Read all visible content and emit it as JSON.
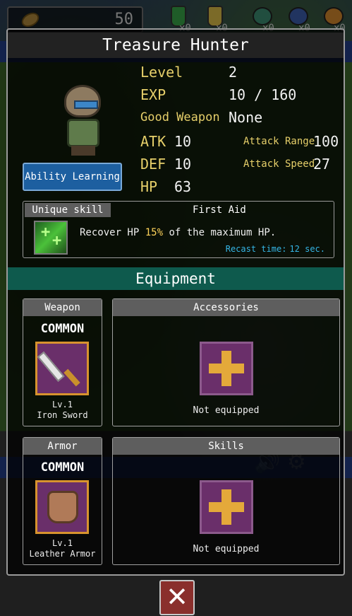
{
  "hud": {
    "gold": "50",
    "items": [
      {
        "icon": "green-potion-icon",
        "count": "x0",
        "color": "#3aa84a"
      },
      {
        "icon": "yellow-potion-icon",
        "count": "x0",
        "color": "#e0c24a"
      },
      {
        "icon": "green-fruit-icon",
        "count": "x0",
        "color": "#3d8f74"
      },
      {
        "icon": "blue-fruit-icon",
        "count": "x0",
        "color": "#3c5fb0"
      },
      {
        "icon": "orange-fruit-icon",
        "count": "x0",
        "color": "#d88a2e"
      }
    ]
  },
  "panel": {
    "title": "Treasure Hunter",
    "ability_button": "Ability Learning",
    "stats": {
      "level_label": "Level",
      "level_value": "2",
      "exp_label": "EXP",
      "exp_value": "10 / 160",
      "good_weapon_label": "Good Weapon",
      "good_weapon_value": "None",
      "atk_label": "ATK",
      "atk_value": "10",
      "def_label": "DEF",
      "def_value": "10",
      "hp_label": "HP",
      "hp_value": "63",
      "range_label": "Attack Range",
      "range_value": "100",
      "speed_label": "Attack Speed",
      "speed_value": "27"
    },
    "unique_skill": {
      "tag": "Unique skill",
      "name": "First Aid",
      "desc_before": "Recover HP",
      "desc_pct": "15%",
      "desc_after": "of the maximum HP.",
      "recast_label": "Recast time:",
      "recast_value": "12 sec."
    },
    "equipment_title": "Equipment",
    "weapon": {
      "header": "Weapon",
      "rarity": "COMMON",
      "level": "Lv.1",
      "name": "Iron Sword"
    },
    "accessories": {
      "header": "Accessories",
      "status": "Not equipped"
    },
    "armor": {
      "header": "Armor",
      "rarity": "COMMON",
      "level": "Lv.1",
      "name": "Leather Armor"
    },
    "skills": {
      "header": "Skills",
      "status": "Not equipped"
    }
  },
  "close_button": "✕",
  "colors": {
    "accent_gold": "#e6cf6a",
    "equipment_bar": "#0e5a4d",
    "recast": "#35b6e6",
    "close": "#8a2f2c"
  }
}
